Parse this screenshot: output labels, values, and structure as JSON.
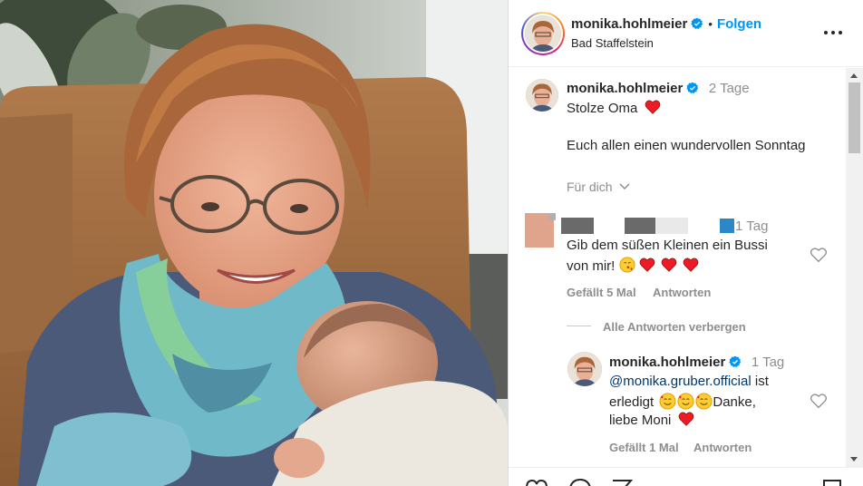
{
  "post": {
    "author": "monika.hohlmeier",
    "follow_label": "Folgen",
    "location": "Bad Staffelstein"
  },
  "caption": {
    "author": "monika.hohlmeier",
    "time": "2 Tage",
    "line1": "Stolze Oma",
    "line2": "Euch allen einen wundervollen Sonntag",
    "translate_label": "Für dich"
  },
  "comment1": {
    "time": "1 Tag",
    "text_line1": "Gib dem süßen Kleinen ein Bussi",
    "text_line2": "von mir!",
    "likes": "Gefällt 5 Mal",
    "reply_label": "Antworten",
    "hide_replies": "Alle Antworten verbergen"
  },
  "reply1": {
    "author": "monika.hohlmeier",
    "time": "1 Tag",
    "mention": "@monika.gruber.official",
    "text_after_mention": "ist",
    "line2_prefix": "erledigt",
    "line2_suffix": "Danke,",
    "line3": "liebe Moni",
    "likes": "Gefällt 1 Mal",
    "reply_label": "Antworten"
  },
  "icons": {
    "verified": "verified-badge-icon",
    "more": "more-options-icon",
    "heart": "heart-icon",
    "chevron": "chevron-down-icon"
  },
  "colors": {
    "accent": "#0095f6",
    "heart_red": "#ed1c24",
    "muted": "#8e8e8e"
  }
}
